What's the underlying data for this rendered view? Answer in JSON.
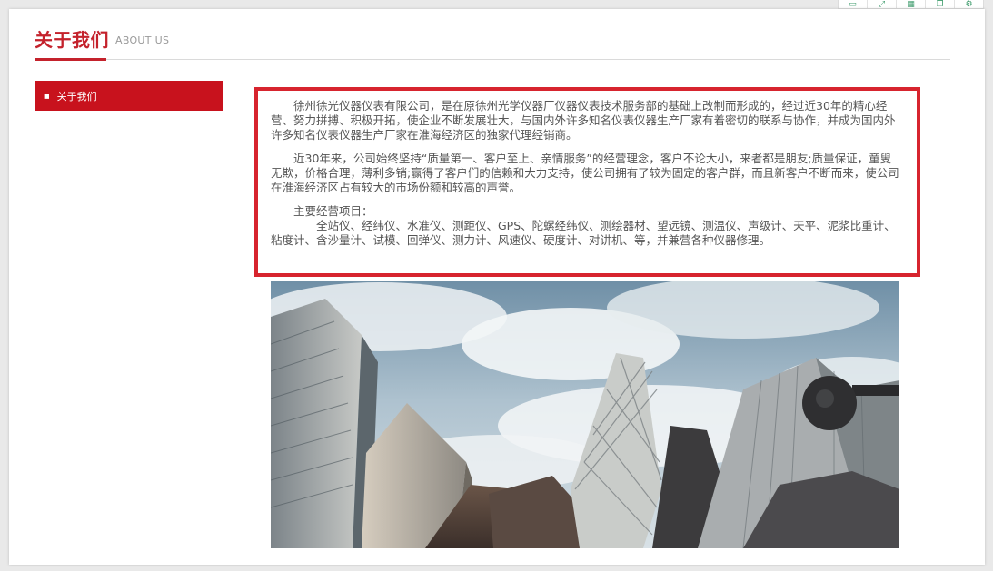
{
  "toolbar": {
    "icons": [
      "window-icon",
      "expand-icon",
      "grid-icon",
      "copy-icon",
      "settings-icon"
    ]
  },
  "header": {
    "title": "关于我们",
    "subtitle": "ABOUT US"
  },
  "sidebar": {
    "items": [
      {
        "label": "关于我们",
        "bullet": "■"
      }
    ]
  },
  "content": {
    "paragraphs": [
      "徐州徐光仪器仪表有限公司，是在原徐州光学仪器厂仪器仪表技术服务部的基础上改制而形成的，经过近30年的精心经营、努力拼搏、积极开拓，使企业不断发展壮大，与国内外许多知名仪表仪器生产厂家有着密切的联系与协作，并成为国内外许多知名仪表仪器生产厂家在淮海经济区的独家代理经销商。",
      "近30年来，公司始终坚持“质量第一、客户至上、亲情服务”的经营理念，客户不论大小，来者都是朋友;质量保证，童叟无欺，价格合理，薄利多销;赢得了客户们的信赖和大力支持，使公司拥有了较为固定的客户群，而且新客户不断而来，使公司在淮海经济区占有较大的市场份额和较高的声誉。"
    ],
    "business_heading": "主要经营项目：",
    "business_items": "全站仪、经纬仪、水准仪、测距仪、GPS、陀螺经纬仪、测绘器材、望远镜、测温仪、声级计、天平、泥浆比重计、粘度计、含沙量计、试模、回弹仪、测力计、风速仪、硬度计、对讲机、等，并兼营各种仪器修理。"
  },
  "colors": {
    "brand_red": "#c4222c",
    "sidebar_red": "#c8121d",
    "box_border": "#d7242e"
  }
}
